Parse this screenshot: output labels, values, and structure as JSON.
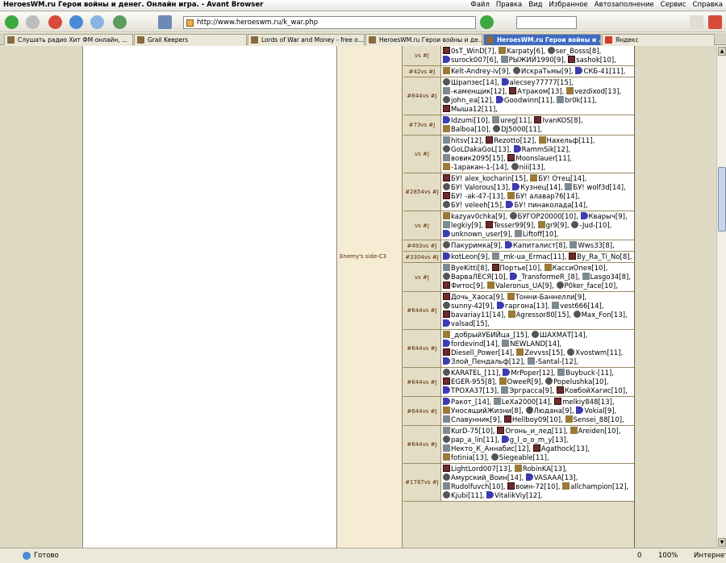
{
  "window": {
    "title": "HeroesWM.ru Герои войны и денег. Онлайн игра. - Avant Browser"
  },
  "menu": [
    "Файл",
    "Правка",
    "Вид",
    "Избранное",
    "Автозаполнение",
    "Сервис",
    "Справка"
  ],
  "address": {
    "url": "http://www.heroeswm.ru/k_war.php"
  },
  "tabs": [
    {
      "label": "Слушать радио Хит ФМ онлайн, ..."
    },
    {
      "label": "Grail Keepers"
    },
    {
      "label": "Lords of War and Money - free o..."
    },
    {
      "label": "HeroesWM.ru Герои войны и де..."
    },
    {
      "label": "HeroesWM.ru Герои войны и ..."
    },
    {
      "label": "Яндекс"
    }
  ],
  "side_label": "Enemy's side-C3",
  "battles": [
    {
      "id": "vs #J",
      "players": [
        "0sT_WinD[7]",
        "Karpaty[6]",
        "ser_Bosss[8]",
        "surock007[6]",
        "РЫЖИЙ1990[9]",
        "sashok[10]"
      ]
    },
    {
      "id": "#42vs #J",
      "players": [
        "Kelt-Andrey-iv[9]",
        "ИскраТьмы[9]",
        "СКБ-41[11]"
      ]
    },
    {
      "id": "#644vs #J",
      "players": [
        "Шрапзес[14]",
        "alecsey77777[15]",
        "-каменщик[12]",
        "Атраком[13]",
        "vezdixod[13]",
        "john_ea[12]",
        "Goodwinn[11]",
        "br0k[11]",
        "Мыша12[11]"
      ]
    },
    {
      "id": "#73vs #J",
      "players": [
        "Idzumi[10]",
        "ureg[11]",
        "IvanKOS[8]",
        "Balboa[10]",
        "DJ5000[11]"
      ]
    },
    {
      "id": "vs #J",
      "players": [
        "hitsv[12]",
        "Rezotto[12]",
        "Нахельф[11]",
        "GoLDakaGoL[13]",
        "RammSik[12]",
        "вовик2095[15]",
        "Moonslauer[11]",
        "-1аракан-1-[14]",
        "niii[13]"
      ]
    },
    {
      "id": "#2854vs #J",
      "players": [
        "БУ! alex_kocharin[15]",
        "БУ! Отец[14]",
        "БУ! Valorous[13]",
        "Кузнец[14]",
        "БУ! wolf3d[14]",
        "БУ! -ak-47-[13]",
        "БУ! алавар76[14]",
        "БУ! veleeh[15]",
        "БУ! пинаколада[14]"
      ]
    },
    {
      "id": "vs #J",
      "players": [
        "kazyav0chka[9]",
        "БУГОР20000[10]",
        "Кварыч[9]",
        "legkiy[9]",
        "Tesser99[9]",
        "gr9[9]",
        "-Jud-[10]",
        "unknown_user[9]",
        "Liftoff[10]"
      ]
    },
    {
      "id": "#493vs #J",
      "players": [
        "Пакуримка[9]",
        "Капиталист[8]",
        "Wws33[8]"
      ]
    },
    {
      "id": "#3304vs #J",
      "players": [
        "kotLeon[9]",
        "_mk-ua_Ermac[11]",
        "By_Ra_Ti_No[8]"
      ]
    },
    {
      "id": "vs #J",
      "players": [
        "ByeKitti[8]",
        "Портье[10]",
        "КассиОпея[10]",
        "ВарваЛЕСЯ[10]",
        "_TransformeR_[8]",
        "Lasgo34[8]",
        "Фитос[9]",
        "Valeronus_UA[9]",
        "P0ker_face[10]"
      ]
    },
    {
      "id": "#644vs #J",
      "players": [
        "Дочь_Хаоса[9]",
        "Тонни-Баннелли[9]",
        "sunny-42[9]",
        "гаргона[13]",
        "vest666[14]",
        "bavariay11[14]",
        "Agressor80[15]",
        "Max_Fon[13]",
        "valsad[15]"
      ]
    },
    {
      "id": "#644vs #J",
      "players": [
        "_добрыйУБИЙца_[15]",
        "ШАХМАТ[14]",
        "fordevind[14]",
        "NEWLAND[14]",
        "Diesell_Power[14]",
        "Zevvss[15]",
        "Xvostwm[11]",
        "Злой_Пендальф[12]",
        "-Santal-[12]"
      ]
    },
    {
      "id": "#644vs #J",
      "players": [
        "KARATEL_[11]",
        "MrPoper[12]",
        "Buybuck-[11]",
        "EGER-955[8]",
        "OweeR[9]",
        "Popelushka[10]",
        "ТРОХА37[13]",
        "Эрграсса[9]",
        "КовбойХагис[10]"
      ]
    },
    {
      "id": "#644vs #J",
      "players": [
        "Ракот_[14]",
        "LeXa2000[14]",
        "melkiy848[13]",
        "УносящийЖизни[8]",
        "Людана[9]",
        "Vokial[9]",
        "Славунник[9]",
        "Hellboy09[10]",
        "Sensei_88[10]"
      ]
    },
    {
      "id": "#644vs #J",
      "players": [
        "KurD-75[10]",
        "Огонь_и_лед[11]",
        "Areiden[10]",
        "pap_a_lin[11]",
        "g_l_o_o_m_y[13]",
        "Некто_К_Аннабис[12]",
        "Agathock[13]",
        "fotinia[13]",
        "Siegeable[11]"
      ]
    },
    {
      "id": "#1787vs #J",
      "players": [
        "LightLord007[13]",
        "RobinKA[13]",
        "Амурский_Воин[14]",
        "VASAAA[13]",
        "Rudolfuvch[10]",
        "воин-72[10]",
        "allchampion[12]",
        "Kjubi[11]",
        "VitalikViy[12]"
      ]
    }
  ],
  "status": {
    "text": "Готово",
    "zoom": "100%",
    "zone": "Интернет",
    "page": "0"
  }
}
